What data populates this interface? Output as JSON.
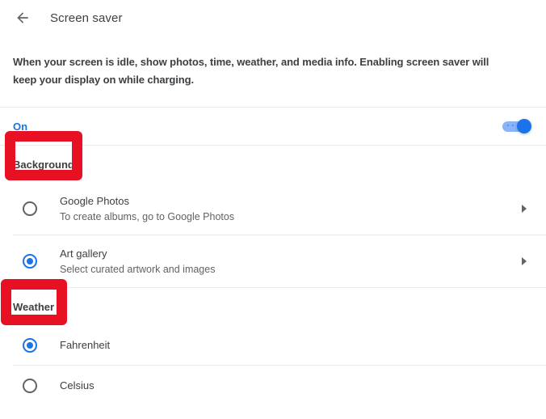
{
  "header": {
    "back_icon": "arrow-left-icon",
    "title": "Screen saver"
  },
  "description": "When your screen is idle, show photos, time, weather, and media info. Enabling screen saver will keep your display on while charging.",
  "enable_row": {
    "label": "On",
    "toggle_state": "on",
    "toggle_on_color": "#1a73e8",
    "toggle_track_color": "#8ab4f8"
  },
  "sections": [
    {
      "heading": "Background",
      "options": [
        {
          "title": "Google Photos",
          "subtitle": "To create albums, go to Google Photos",
          "selected": false,
          "chevron": "chevron-right-icon"
        },
        {
          "title": "Art gallery",
          "subtitle": "Select curated artwork and images",
          "selected": true,
          "chevron": "chevron-right-icon"
        }
      ]
    },
    {
      "heading": "Weather",
      "options": [
        {
          "title": "Fahrenheit",
          "selected": true
        },
        {
          "title": "Celsius",
          "selected": false
        }
      ]
    }
  ],
  "annotations": [
    {
      "target": "Background",
      "color": "#e81123"
    },
    {
      "target": "Weather",
      "color": "#e81123"
    }
  ]
}
